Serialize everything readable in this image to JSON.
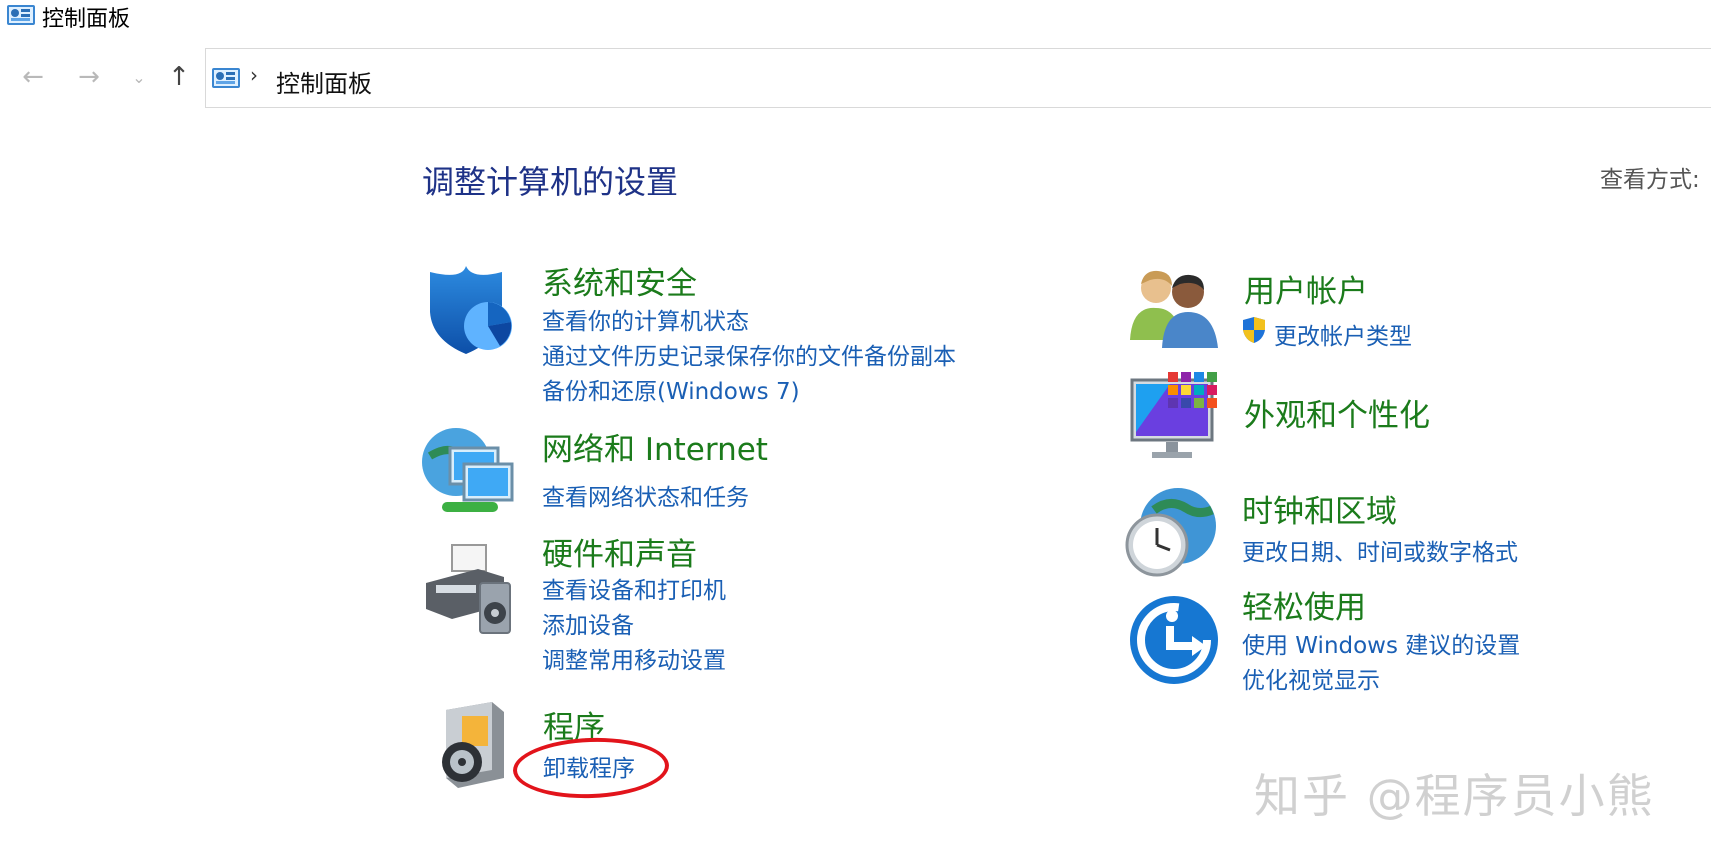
{
  "window": {
    "title": "控制面板"
  },
  "nav": {
    "back_icon": "arrow-left-icon",
    "forward_icon": "arrow-right-icon",
    "recent_icon": "chevron-down-icon",
    "up_icon": "arrow-up-icon"
  },
  "address": {
    "breadcrumb": "控制面板",
    "separator": "›"
  },
  "main": {
    "heading": "调整计算机的设置",
    "view_by_label": "查看方式:"
  },
  "categories": {
    "system": {
      "title": "系统和安全",
      "icon": "shield-icon",
      "links": [
        "查看你的计算机状态",
        "通过文件历史记录保存你的文件备份副本",
        "备份和还原(Windows 7)"
      ]
    },
    "network": {
      "title": "网络和 Internet",
      "icon": "network-globe-icon",
      "links": [
        "查看网络状态和任务"
      ]
    },
    "hardware": {
      "title": "硬件和声音",
      "icon": "printer-speaker-icon",
      "links": [
        "查看设备和打印机",
        "添加设备",
        "调整常用移动设置"
      ]
    },
    "programs": {
      "title": "程序",
      "icon": "programs-disc-icon",
      "links": [
        "卸载程序"
      ]
    },
    "users": {
      "title": "用户帐户",
      "icon": "users-icon",
      "links": [
        "更改帐户类型"
      ],
      "link_icon": "uac-shield-icon"
    },
    "appearance": {
      "title": "外观和个性化",
      "icon": "monitor-palette-icon",
      "links": []
    },
    "clock": {
      "title": "时钟和区域",
      "icon": "clock-globe-icon",
      "links": [
        "更改日期、时间或数字格式"
      ]
    },
    "ease": {
      "title": "轻松使用",
      "icon": "ease-of-access-icon",
      "links": [
        "使用 Windows 建议的设置",
        "优化视觉显示"
      ]
    }
  },
  "annotation": {
    "highlight_color": "#e2141b"
  },
  "watermark": {
    "text": "知乎 @程序员小熊"
  },
  "colors": {
    "heading": "#1e3287",
    "category_title": "#1b7b1b",
    "link": "#1a5fb4"
  }
}
